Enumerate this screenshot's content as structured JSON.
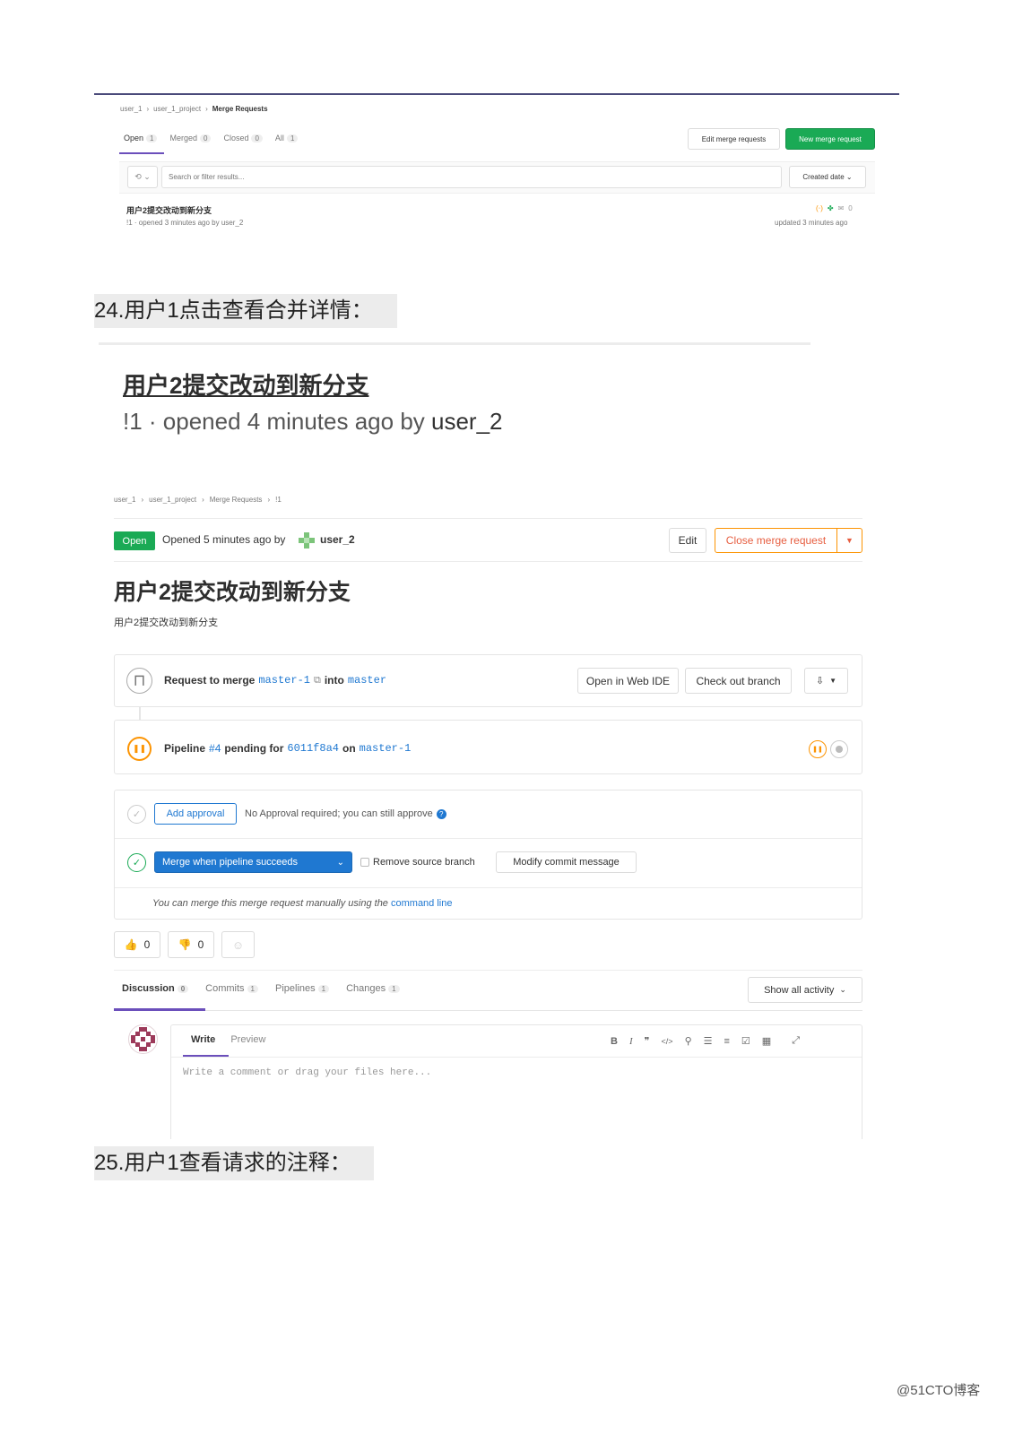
{
  "mr_list": {
    "breadcrumb": [
      "user_1",
      "user_1_project",
      "Merge Requests"
    ],
    "tabs": [
      {
        "label": "Open",
        "count": "1"
      },
      {
        "label": "Merged",
        "count": "0"
      },
      {
        "label": "Closed",
        "count": "0"
      },
      {
        "label": "All",
        "count": "1"
      }
    ],
    "edit_button": "Edit merge requests",
    "new_button": "New merge request",
    "search_placeholder": "Search or filter results...",
    "sort_label": "Created date",
    "item": {
      "title": "用户2提交改动到新分支",
      "meta": "!1 · opened 3 minutes ago by user_2",
      "comments": "0",
      "updated": "updated 3 minutes ago"
    }
  },
  "caption_24": "24.用户1点击查看合并详情：",
  "zoom": {
    "title": "用户2提交改动到新分支",
    "meta_prefix": "!1 · opened 4 minutes ago by ",
    "meta_author": "user_2"
  },
  "detail": {
    "breadcrumb": [
      "user_1",
      "user_1_project",
      "Merge Requests",
      "!1"
    ],
    "status_badge": "Open",
    "opened_text": "Opened 5 minutes ago by",
    "author": "user_2",
    "edit_button": "Edit",
    "close_button": "Close merge request",
    "title": "用户2提交改动到新分支",
    "description": "用户2提交改动到新分支",
    "merge_box": {
      "request_prefix": "Request to merge",
      "source_branch": "master-1",
      "into_word": "into",
      "target_branch": "master",
      "web_ide_button": "Open in Web IDE",
      "checkout_button": "Check out branch"
    },
    "pipeline": {
      "prefix": "Pipeline",
      "id": "#4",
      "middle": "pending for",
      "commit": "6011f8a4",
      "on_word": "on",
      "branch": "master-1"
    },
    "approval": {
      "button": "Add approval",
      "text": "No Approval required; you can still approve"
    },
    "merge": {
      "button": "Merge when pipeline succeeds",
      "remove_source": "Remove source branch",
      "modify_commit": "Modify commit message",
      "manual_text": "You can merge this merge request manually using the",
      "manual_link": "command line"
    },
    "reactions": {
      "thumbs_up": "0",
      "thumbs_down": "0"
    },
    "tabs": [
      {
        "label": "Discussion",
        "count": "0"
      },
      {
        "label": "Commits",
        "count": "1"
      },
      {
        "label": "Pipelines",
        "count": "1"
      },
      {
        "label": "Changes",
        "count": "1"
      }
    ],
    "activity_filter": "Show all activity",
    "editor": {
      "write_tab": "Write",
      "preview_tab": "Preview",
      "placeholder": "Write a comment or drag your files here..."
    }
  },
  "caption_25": "25.用户1查看请求的注释：",
  "watermark": "@51CTO博客",
  "colors": {
    "green": "#1aaa55",
    "blue": "#1f78d1",
    "orange": "#fc9403",
    "purple": "#6b4fbb"
  }
}
